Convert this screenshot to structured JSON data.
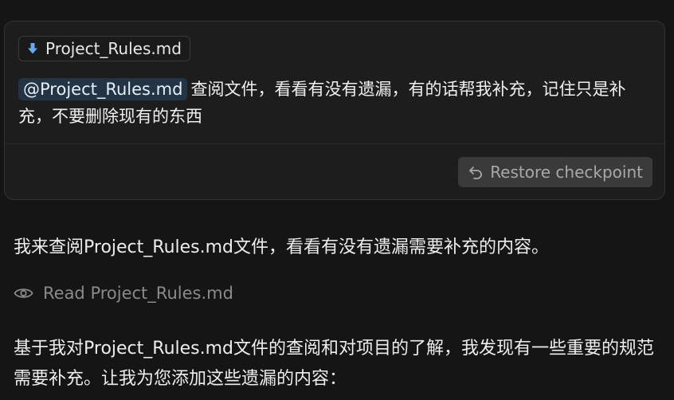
{
  "user_message": {
    "attachment": {
      "file_name": "Project_Rules.md",
      "icon": "download-arrow-icon"
    },
    "mention": "@Project_Rules.md",
    "text": "查阅文件，看看有没有遗漏，有的话帮我补充，记住只是补充，不要删除现有的东西",
    "restore_button": {
      "label": "Restore checkpoint",
      "icon": "undo-arrow-icon"
    }
  },
  "assistant": {
    "intro": "我来查阅Project_Rules.md文件，看看有没有遗漏需要补充的内容。",
    "tool_call": {
      "icon": "eye-icon",
      "label": "Read Project_Rules.md"
    },
    "followup": "基于我对Project_Rules.md文件的查阅和对项目的了解，我发现有一些重要的规范需要补充。让我为您添加这些遗漏的内容："
  },
  "colors": {
    "background": "#151515",
    "card": "#1d1d1d",
    "mention_bg": "#233444",
    "download_icon": "#6aa8e8",
    "muted_text": "#8a8a8a"
  }
}
